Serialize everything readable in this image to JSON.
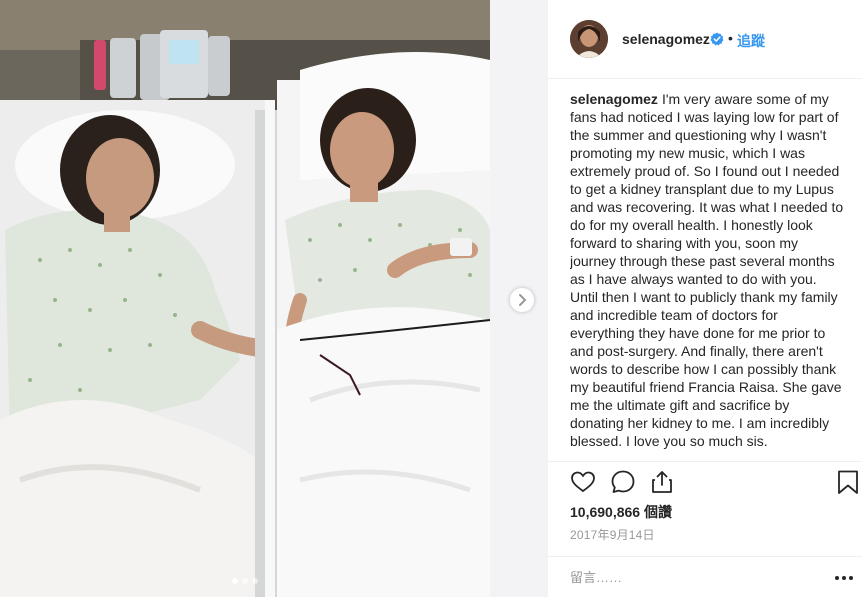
{
  "post": {
    "username": "selenagomez",
    "follow_label": "追蹤",
    "dot_separator": "•",
    "caption": "I'm very aware some of my fans had noticed I was laying low for part of the summer and questioning why I wasn't promoting my new music, which I was extremely proud of. So I found out I needed to get a kidney transplant due to my Lupus and was recovering. It was what I needed to do for my overall health. I honestly look forward to sharing with you, soon my journey through these past several months as I have always wanted to do with you. Until then I want to publicly thank my family and incredible team of doctors for everything they have done for me prior to and post-surgery. And finally, there aren't words to describe how I can possibly thank my beautiful friend Francia Raisa. She gave me the ultimate gift and sacrifice by donating her kidney to me. I am incredibly blessed. I love you so much sis.",
    "views": "10,690,866 個讚",
    "date": "2017年9月14日",
    "comment_placeholder": "留言……"
  },
  "icons": {
    "verified": "verified-badge-icon",
    "like": "heart-icon",
    "comment": "comment-bubble-icon",
    "share": "share-icon",
    "save": "bookmark-icon",
    "more": "more-dots-icon",
    "next": "chevron-right-icon"
  },
  "carousel": {
    "slide_count": 3,
    "current_index": 0
  },
  "colors": {
    "link": "#3897f0",
    "verified": "#3897f0",
    "text": "#262626",
    "muted": "#999999",
    "border": "#efefef"
  }
}
